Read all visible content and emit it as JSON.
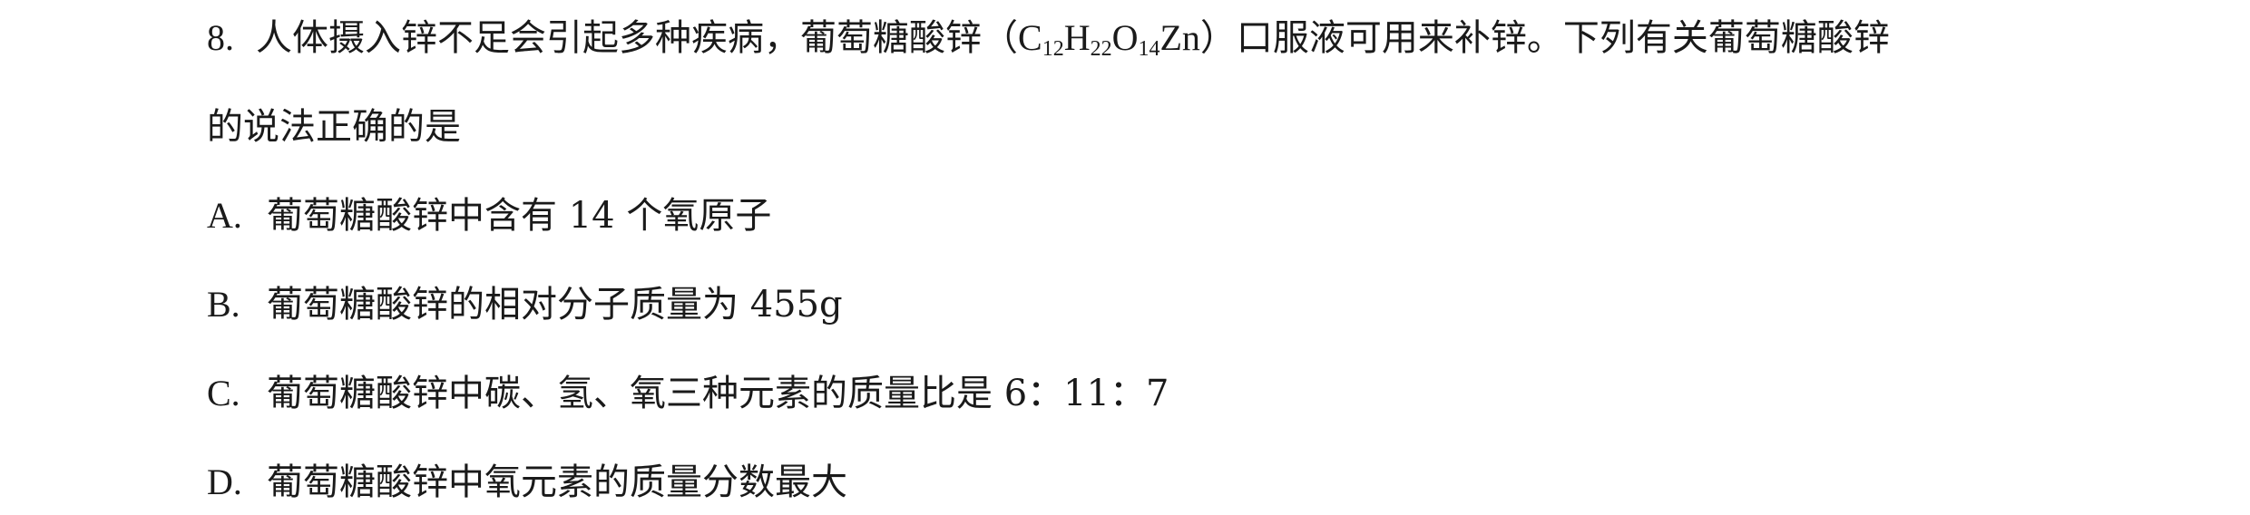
{
  "question": {
    "number": "8.",
    "stem_part1": "人体摄入锌不足会引起多种疾病，葡萄糖酸锌（",
    "formula": {
      "c": "C",
      "c_sub": "12",
      "h": "H",
      "h_sub": "22",
      "o": "O",
      "o_sub": "14",
      "zn": "Zn"
    },
    "stem_part2": "）口服液可用来补锌。下列有关葡萄糖酸锌",
    "stem_line2": "的说法正确的是",
    "options": [
      {
        "letter": "A.",
        "text": "葡萄糖酸锌中含有 14 个氧原子"
      },
      {
        "letter": "B.",
        "text": "葡萄糖酸锌的相对分子质量为 455g"
      },
      {
        "letter": "C.",
        "text": "葡萄糖酸锌中碳、氢、氧三种元素的质量比是 6：11：7"
      },
      {
        "letter": "D.",
        "text": "葡萄糖酸锌中氧元素的质量分数最大"
      }
    ]
  }
}
